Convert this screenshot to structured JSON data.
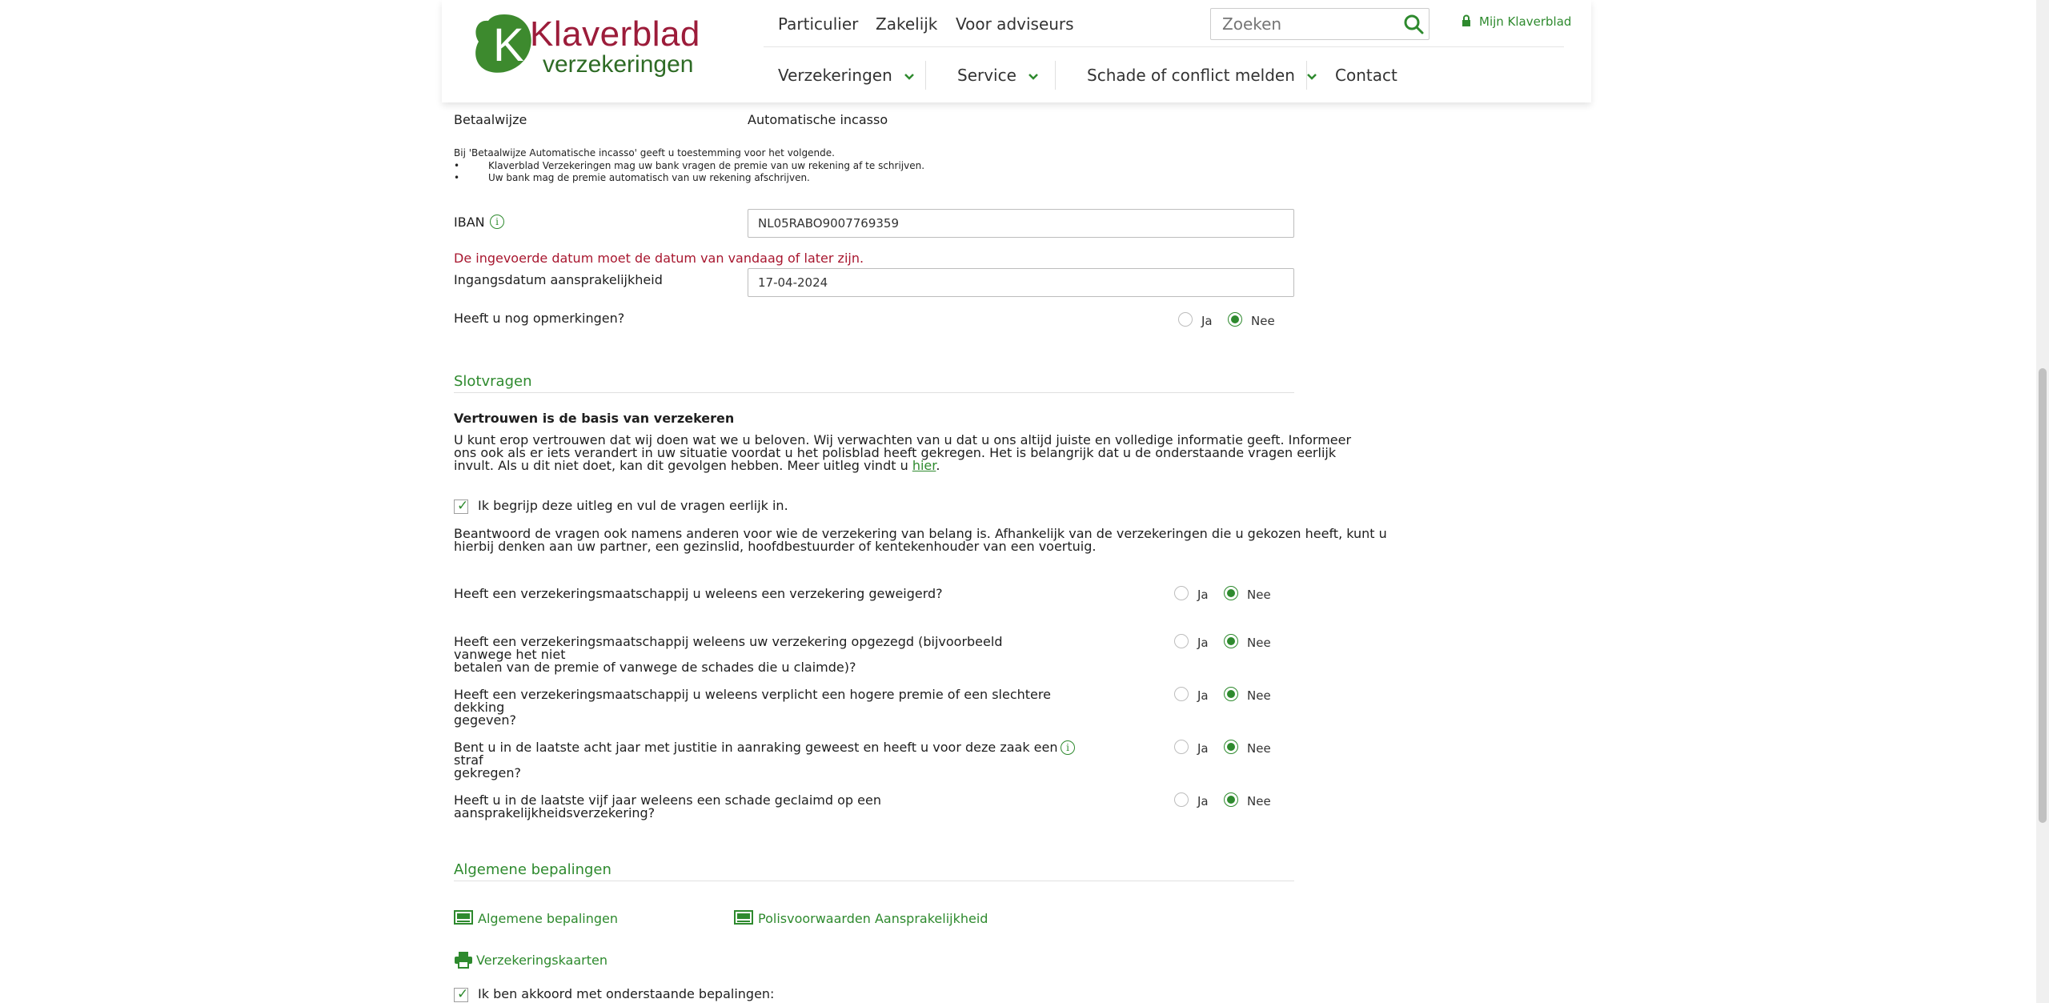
{
  "header": {
    "logo": {
      "brand": "Klaverblad",
      "sub": "verzekeringen"
    },
    "top_links": [
      "Particulier",
      "Zakelijk",
      "Voor adviseurs"
    ],
    "search_placeholder": "Zoeken",
    "mijn": "Mijn Klaverblad",
    "main_nav": [
      "Verzekeringen",
      "Service",
      "Schade of conflict melden",
      "Contact"
    ]
  },
  "payment": {
    "label": "Betaalwijze",
    "value": "Automatische incasso",
    "consent_intro": "Bij 'Betaalwijze Automatische incasso' geeft u toestemming voor het volgende.",
    "consent_items": [
      "Klaverblad Verzekeringen mag uw bank vragen de premie van uw rekening af te schrijven.",
      "Uw bank mag de premie automatisch van uw rekening afschrijven."
    ],
    "iban_label": "IBAN",
    "iban_value": "NL05RABO9007769359",
    "date_error": "De ingevoerde datum moet de datum van vandaag of later zijn.",
    "date_label": "Ingangsdatum aansprakelijkheid",
    "date_value": "17-04-2024",
    "remarks_label": "Heeft u nog opmerkingen?"
  },
  "radio_labels": {
    "yes": "Ja",
    "no": "Nee"
  },
  "slotvragen": {
    "title": "Slotvragen",
    "subtitle": "Vertrouwen is de basis van verzekeren",
    "intro_lines": [
      "U kunt erop vertrouwen dat wij doen wat we u beloven. Wij verwachten van u dat u ons altijd juiste en volledige informatie geeft. Informeer",
      "ons ook als er iets verandert in uw situatie voordat u het polisblad heeft gekregen. Het is belangrijk dat u de onderstaande vragen eerlijk"
    ],
    "intro_last": "invult. Als u dit niet doet, kan dit gevolgen hebben. Meer uitleg vindt u ",
    "intro_link": "hier",
    "intro_end": ".",
    "agree_label": "Ik begrijp deze uitleg en vul de vragen eerlijk in.",
    "answer_lines": [
      "Beantwoord de vragen ook namens anderen voor wie de verzekering van belang is. Afhankelijk van de verzekeringen die u gekozen heeft, kunt u",
      "hierbij denken aan uw partner, een gezinslid, hoofdbestuurder of kentekenhouder van een voertuig."
    ],
    "questions": [
      {
        "lines": [
          "Heeft een verzekeringsmaatschappij u weleens een verzekering geweigerd?"
        ]
      },
      {
        "lines": [
          "Heeft een verzekeringsmaatschappij weleens uw verzekering opgezegd (bijvoorbeeld vanwege het niet",
          "betalen van de premie of vanwege de schades die u claimde)?"
        ]
      },
      {
        "lines": [
          "Heeft een verzekeringsmaatschappij u weleens verplicht een hogere premie of een slechtere dekking",
          "gegeven?"
        ]
      },
      {
        "lines": [
          "Bent u in de laatste acht jaar met justitie in aanraking geweest en heeft u voor deze zaak een straf",
          "gekregen?"
        ]
      },
      {
        "lines": [
          "Heeft u in de laatste vijf jaar weleens een schade geclaimd op een aansprakelijkheidsverzekering?"
        ]
      }
    ]
  },
  "algemene": {
    "title": "Algemene bepalingen",
    "docs": [
      "Algemene bepalingen",
      "Polisvoorwaarden Aansprakelijkheid"
    ],
    "cards": "Verzekeringskaarten",
    "agree_label": "Ik ben akkoord met onderstaande bepalingen:"
  }
}
